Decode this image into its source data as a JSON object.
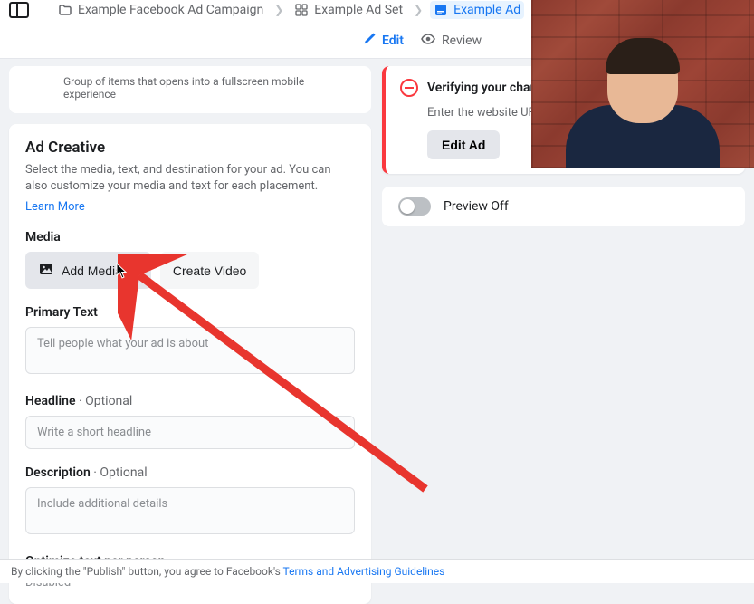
{
  "breadcrumb": {
    "campaign": "Example Facebook Ad Campaign",
    "adset": "Example Ad Set",
    "ad": "Example Ad"
  },
  "tabs": {
    "edit": "Edit",
    "review": "Review"
  },
  "group_hint": "Group of items that opens into a fullscreen mobile experience",
  "creative": {
    "title": "Ad Creative",
    "desc": "Select the media, text, and destination for your ad. You can also customize your media and text for each placement.",
    "learn_more": "Learn More"
  },
  "media": {
    "label": "Media",
    "add_media": "Add Media",
    "create_video": "Create Video"
  },
  "primary_text": {
    "label": "Primary Text",
    "placeholder": "Tell people what your ad is about"
  },
  "headline": {
    "label": "Headline",
    "optional": " · Optional",
    "placeholder": "Write a short headline"
  },
  "description": {
    "label": "Description",
    "optional": " · Optional",
    "placeholder": "Include additional details"
  },
  "optimize": {
    "label": "Optimize text per person",
    "value": "Disabled"
  },
  "alert": {
    "title": "Verifying your chang",
    "body": "Enter the website UR",
    "button": "Edit Ad"
  },
  "preview": {
    "label": "Preview Off"
  },
  "footer": {
    "pre": "By clicking the \"Publish\" button, you agree to Facebook's ",
    "link": "Terms and Advertising Guidelines"
  }
}
